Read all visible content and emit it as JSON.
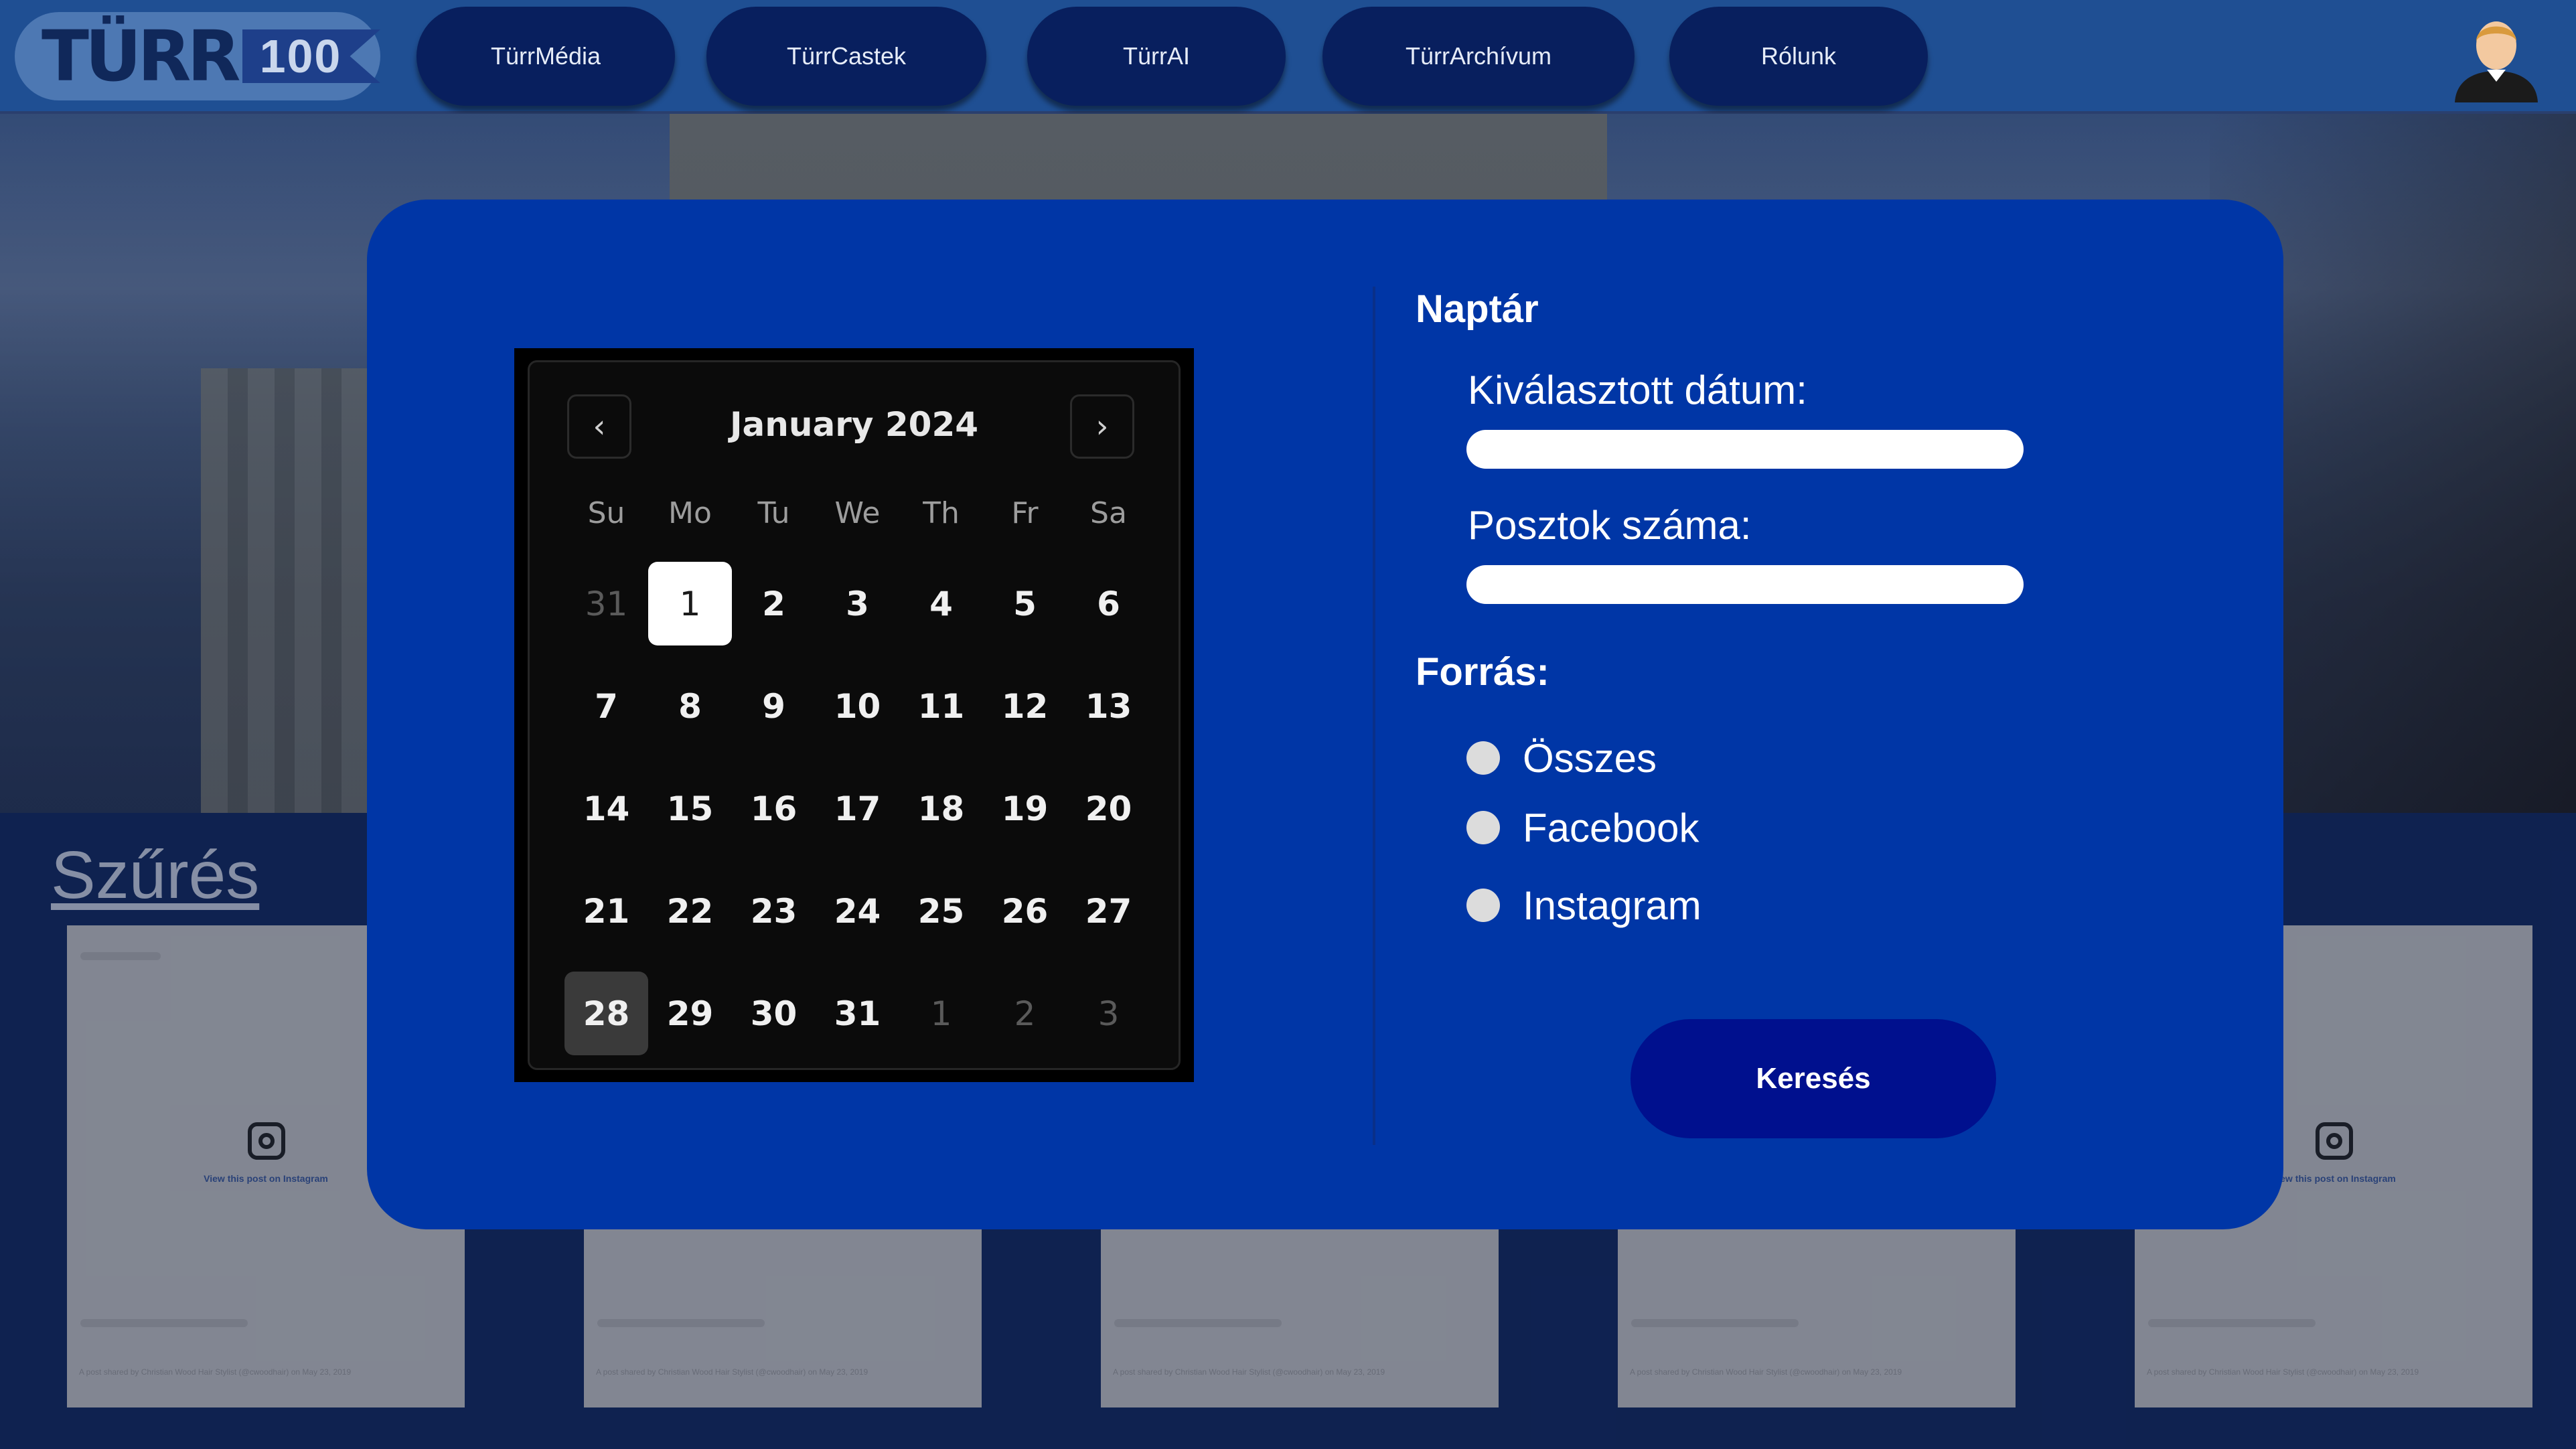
{
  "colors": {
    "topbar": "#1f4f93",
    "nav_button": "#081f5e",
    "modal": "#0036a6",
    "search_button": "#00108e",
    "calendar_bg": "#0b0b0b"
  },
  "header": {
    "logo": {
      "word": "TÜRR",
      "number": "100"
    },
    "nav": [
      {
        "label": "TürrMédia"
      },
      {
        "label": "TürrCastek"
      },
      {
        "label": "TürrAI"
      },
      {
        "label": "TürrArchívum"
      },
      {
        "label": "Rólunk"
      }
    ],
    "avatar_icon": "user-avatar-icon"
  },
  "background": {
    "filter_heading": "Szűrés",
    "post_cards": [
      {
        "link_text": "View this post on Instagram",
        "caption": "A post shared by Christian Wood Hair Stylist (@cwoodhair) on May 23, 2019"
      },
      {
        "link_text": "",
        "caption": "A post shared by Christian Wood Hair Stylist (@cwoodhair) on May 23, 2019"
      },
      {
        "link_text": "",
        "caption": "A post shared by Christian Wood Hair Stylist (@cwoodhair) on May 23, 2019"
      },
      {
        "link_text": "",
        "caption": "A post shared by Christian Wood Hair Stylist (@cwoodhair) on May 23, 2019"
      },
      {
        "link_text": "View this post on Instagram",
        "caption": "A post shared by Christian Wood Hair Stylist (@cwoodhair) on May 23, 2019"
      }
    ]
  },
  "calendar": {
    "title": "January 2024",
    "prev_icon": "chevron-left-icon",
    "next_icon": "chevron-right-icon",
    "prev_glyph": "‹",
    "next_glyph": "›",
    "weekdays": [
      "Su",
      "Mo",
      "Tu",
      "We",
      "Th",
      "Fr",
      "Sa"
    ],
    "days": [
      {
        "label": "31",
        "state": "muted"
      },
      {
        "label": "1",
        "state": "selected"
      },
      {
        "label": "2",
        "state": ""
      },
      {
        "label": "3",
        "state": ""
      },
      {
        "label": "4",
        "state": ""
      },
      {
        "label": "5",
        "state": ""
      },
      {
        "label": "6",
        "state": ""
      },
      {
        "label": "7",
        "state": ""
      },
      {
        "label": "8",
        "state": ""
      },
      {
        "label": "9",
        "state": ""
      },
      {
        "label": "10",
        "state": ""
      },
      {
        "label": "11",
        "state": ""
      },
      {
        "label": "12",
        "state": ""
      },
      {
        "label": "13",
        "state": ""
      },
      {
        "label": "14",
        "state": ""
      },
      {
        "label": "15",
        "state": ""
      },
      {
        "label": "16",
        "state": ""
      },
      {
        "label": "17",
        "state": ""
      },
      {
        "label": "18",
        "state": ""
      },
      {
        "label": "19",
        "state": ""
      },
      {
        "label": "20",
        "state": ""
      },
      {
        "label": "21",
        "state": ""
      },
      {
        "label": "22",
        "state": ""
      },
      {
        "label": "23",
        "state": ""
      },
      {
        "label": "24",
        "state": ""
      },
      {
        "label": "25",
        "state": ""
      },
      {
        "label": "26",
        "state": ""
      },
      {
        "label": "27",
        "state": ""
      },
      {
        "label": "28",
        "state": "today"
      },
      {
        "label": "29",
        "state": ""
      },
      {
        "label": "30",
        "state": ""
      },
      {
        "label": "31",
        "state": ""
      },
      {
        "label": "1",
        "state": "muted"
      },
      {
        "label": "2",
        "state": "muted"
      },
      {
        "label": "3",
        "state": "muted"
      }
    ]
  },
  "panel": {
    "title": "Naptár",
    "selected_date_label": "Kiválasztott dátum:",
    "selected_date_value": "",
    "post_count_label": "Posztok száma:",
    "post_count_value": "",
    "source_title": "Forrás:",
    "sources": [
      {
        "label": "Összes",
        "checked": false
      },
      {
        "label": "Facebook",
        "checked": false
      },
      {
        "label": "Instagram",
        "checked": false
      }
    ],
    "search_button": "Keresés"
  }
}
